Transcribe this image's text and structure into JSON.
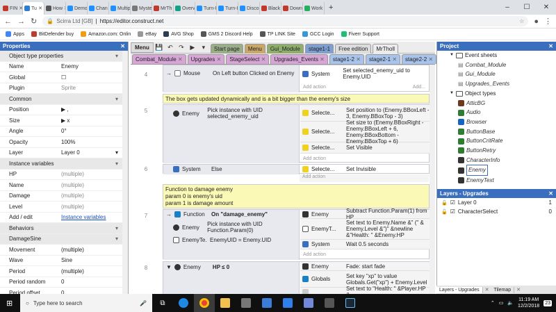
{
  "browser": {
    "tabs": [
      {
        "label": "FIN",
        "color": "#c0392b"
      },
      {
        "label": "Tu",
        "color": "#2d7dd2",
        "active": true
      },
      {
        "label": "How",
        "color": "#555"
      },
      {
        "label": "Demo",
        "color": "#1e90ff"
      },
      {
        "label": "Chan",
        "color": "#1e90ff"
      },
      {
        "label": "Multip",
        "color": "#1e90ff"
      },
      {
        "label": "Myste",
        "color": "#777"
      },
      {
        "label": "MrTh",
        "color": "#c0392b"
      },
      {
        "label": "Overvi",
        "color": "#16a085"
      },
      {
        "label": "Turn-I",
        "color": "#1e90ff"
      },
      {
        "label": "Turn-I",
        "color": "#1e90ff"
      },
      {
        "label": "Discor",
        "color": "#1e90ff"
      },
      {
        "label": "Black",
        "color": "#c0392b"
      },
      {
        "label": "Down",
        "color": "#c0392b"
      },
      {
        "label": "Work",
        "color": "#27ae60"
      }
    ],
    "site_label": "Scirra Ltd [GB]",
    "url": "https://editor.construct.net",
    "bookmarks": [
      {
        "label": "Apps",
        "color": "#4285f4"
      },
      {
        "label": "BitDefender buy",
        "color": "#c0392b"
      },
      {
        "label": "Amazon.com: Onlin",
        "color": "#f39c12"
      },
      {
        "label": "eBay",
        "color": "#999"
      },
      {
        "label": "AVG Shop",
        "color": "#2c3e50"
      },
      {
        "label": "GMS 2 Discord Help",
        "color": "#555"
      },
      {
        "label": "TP LINK Site",
        "color": "#555"
      },
      {
        "label": "GCC Login",
        "color": "#3498db"
      },
      {
        "label": "Fiverr Support",
        "color": "#1dbf73"
      }
    ]
  },
  "properties": {
    "title": "Properties",
    "rows": [
      {
        "k": "Object type properties",
        "v": "",
        "sec": true
      },
      {
        "k": "Name",
        "v": "Enemy"
      },
      {
        "k": "Global",
        "v": "☐"
      },
      {
        "k": "Plugin",
        "v": "Sprite",
        "mute": true
      },
      {
        "k": "Common",
        "v": "",
        "sec": true
      },
      {
        "k": "Position",
        "v": "▶  ,"
      },
      {
        "k": "Size",
        "v": "▶  x"
      },
      {
        "k": "Angle",
        "v": "0°"
      },
      {
        "k": "Opacity",
        "v": "100%"
      },
      {
        "k": "Layer",
        "v": "Layer 0"
      },
      {
        "k": "Instance variables",
        "v": "",
        "sec": true
      },
      {
        "k": "HP",
        "v": "(multiple)",
        "mute": true
      },
      {
        "k": "Name",
        "v": "(multiple)",
        "mute": true
      },
      {
        "k": "Damage",
        "v": "(multiple)",
        "mute": true
      },
      {
        "k": "Level",
        "v": "(multiple)",
        "mute": true
      },
      {
        "k": "Add / edit",
        "v": "Instance variables",
        "link": true
      },
      {
        "k": "Behaviors",
        "v": "",
        "sec": true
      },
      {
        "k": "DamageSine",
        "v": "",
        "sec": true
      },
      {
        "k": "Movement",
        "v": "(multiple)"
      },
      {
        "k": "Wave",
        "v": "Sine"
      },
      {
        "k": "Period",
        "v": "(multiple)"
      },
      {
        "k": "Period random",
        "v": "0"
      },
      {
        "k": "Period offset",
        "v": "0"
      }
    ]
  },
  "editor": {
    "menu_label": "Menu",
    "top_tabs": [
      {
        "label": "Start page",
        "color": "#9aae8a"
      },
      {
        "label": "Menu",
        "color": "#c9a86a"
      },
      {
        "label": "Gui_Module",
        "color": "#8fae6e"
      },
      {
        "label": "stage1-1",
        "color": "#7f9fd0"
      },
      {
        "label": "Free edition",
        "color": "#ddd"
      },
      {
        "label": "MrTholl",
        "color": "#ececec"
      }
    ],
    "second_tabs": [
      {
        "label": "Combat_Module",
        "color": "#d7a6d6"
      },
      {
        "label": "Upgrades",
        "color": "#d7a6d6"
      },
      {
        "label": "StageSelect",
        "color": "#d7a6d6"
      },
      {
        "label": "Upgrades_Events",
        "color": "#d7a6d6"
      },
      {
        "label": "stage1-2",
        "color": "#a9c4ec"
      },
      {
        "label": "stage2-1",
        "color": "#a9c4ec"
      },
      {
        "label": "stage2-2",
        "color": "#a9c4ec"
      }
    ],
    "add_action": "Add action",
    "events": {
      "e4": {
        "num": "4",
        "obj": "Mouse",
        "cond": "On Left button Clicked on Enemy",
        "a_obj": "System",
        "a_text": "Set selected_enemy_uid to Enemy.UID"
      },
      "c1": "The box gets updated dynamically and is a bit bigger than the enemy's size",
      "e5": {
        "num": "5",
        "obj": "Enemy",
        "cond": "Pick instance with UID selected_enemy_uid",
        "acts": [
          {
            "obj": "Selecte...",
            "text": "Set position to (Enemy.BBoxLeft - 3, Enemy.BBoxTop - 3)"
          },
          {
            "obj": "Selecte...",
            "text": "Set size to (Enemy.BBoxRight - Enemy.BBoxLeft + 6, Enemy.BBoxBottom - Enemy.BBoxTop + 6)"
          },
          {
            "obj": "Selecte...",
            "text": "Set Visible"
          }
        ]
      },
      "e6": {
        "num": "6",
        "obj": "System",
        "cond": "Else",
        "a_obj": "Selecte...",
        "a_text": "Set Invisible"
      },
      "c2": "Function to damage enemy\nparam 0 is enemy's uid\nparam 1 is damage amount",
      "e7": {
        "num": "7",
        "c1_obj": "Function",
        "c1": "On \"damage_enemy\"",
        "c2_obj": "Enemy",
        "c2": "Pick instance with UID Function.Param(0)",
        "c3_obj": "EnemyTe...",
        "c3": "EnemyUID = Enemy.UID",
        "acts": [
          {
            "obj": "Enemy",
            "text": "Subtract Function.Param(1) from HP"
          },
          {
            "obj": "EnemyT...",
            "text": "Set text to Enemy.Name &\" (\" & Enemy.Level &\")\" &newline &\"Health: \" &Enemy.HP"
          },
          {
            "obj": "System",
            "text": "Wait 0.5 seconds"
          }
        ]
      },
      "e8": {
        "num": "8",
        "obj": "Enemy",
        "cond": "HP ≤ 0",
        "acts": [
          {
            "obj": "Enemy",
            "text": "Fade: start fade"
          },
          {
            "obj": "Globals",
            "text": "Set key \"xp\" to value Globals.Get(\"xp\") + Enemy.Level"
          },
          {
            "obj": "",
            "text": "Set text to \"Health: \" &Player.HP &"
          }
        ]
      }
    }
  },
  "project": {
    "title": "Project",
    "items": [
      {
        "label": "Event sheets",
        "type": "folder",
        "indent": 1
      },
      {
        "label": "Combat_Module",
        "type": "sheet",
        "indent": 2
      },
      {
        "label": "Gui_Module",
        "type": "sheet",
        "indent": 2
      },
      {
        "label": "Upgrades_Events",
        "type": "sheet",
        "indent": 2
      },
      {
        "label": "Object types",
        "type": "folder",
        "indent": 1
      },
      {
        "label": "AtticBG",
        "type": "obj",
        "indent": 2,
        "color": "#6b3a1f"
      },
      {
        "label": "Audio",
        "type": "obj",
        "indent": 2,
        "color": "#2e7d32"
      },
      {
        "label": "Browser",
        "type": "obj",
        "indent": 2,
        "color": "#1565c0"
      },
      {
        "label": "ButtonBase",
        "type": "obj",
        "indent": 2,
        "color": "#2e7d32"
      },
      {
        "label": "ButtonCritRate",
        "type": "obj",
        "indent": 2,
        "color": "#2e7d32"
      },
      {
        "label": "ButtonRetry",
        "type": "obj",
        "indent": 2,
        "color": "#2e7d32"
      },
      {
        "label": "CharacterInfo",
        "type": "obj",
        "indent": 2,
        "color": "#333"
      },
      {
        "label": "Enemy",
        "type": "obj",
        "indent": 2,
        "color": "#333",
        "selected": true
      },
      {
        "label": "EnemyText",
        "type": "obj",
        "indent": 2,
        "color": "#333"
      }
    ]
  },
  "layers": {
    "title": "Layers - Upgrades",
    "items": [
      {
        "label": "Layer 0",
        "num": "1"
      },
      {
        "label": "CharacterSelect",
        "num": "0"
      }
    ],
    "tabs": [
      "Layers - Upgrades",
      "Tilemap"
    ]
  },
  "taskbar": {
    "search_placeholder": "Type here to search",
    "time": "11:19 AM",
    "date": "12/2/2018",
    "badge": "23"
  }
}
